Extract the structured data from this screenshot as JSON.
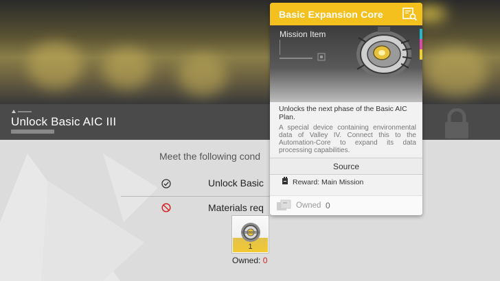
{
  "mission": {
    "title": "Unlock Basic AIC III",
    "conditions_intro": "Meet the following cond",
    "conditions": [
      {
        "label": "Unlock Basic",
        "state": "completed",
        "icon": "check-circle-icon"
      },
      {
        "label": "Materials req",
        "state": "blocked",
        "icon": "ban-icon"
      }
    ],
    "material": {
      "count": "1",
      "owned_label": "Owned:",
      "owned_value": "0"
    }
  },
  "tooltip": {
    "title": "Basic Expansion Core",
    "type": "Mission Item",
    "header_icon": "search-doc-icon",
    "description": "Unlocks the next phase of the Basic AIC Plan.",
    "lore": "A special device containing environmental data of Valley IV. Connect this to the Automation-Core to expand its data processing capabilities.",
    "source_heading": "Source",
    "source_entry": "Reward: Main Mission",
    "owned_label": "Owned",
    "owned_value": "0"
  },
  "colors": {
    "accent_yellow": "#f4c01e",
    "owned_red": "#d62222",
    "title_bar": "#4a4a4a",
    "strip": [
      "#27b7c9",
      "#d94aa4",
      "#f0d02c"
    ]
  }
}
